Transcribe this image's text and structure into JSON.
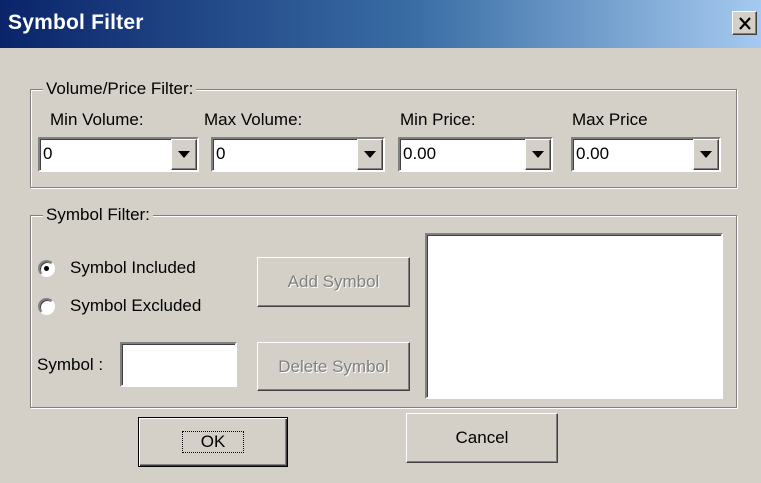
{
  "window": {
    "title": "Symbol Filter",
    "close_icon": "close-icon"
  },
  "volume_price_filter": {
    "legend": "Volume/Price Filter:",
    "min_volume": {
      "label": "Min Volume:",
      "value": "0"
    },
    "max_volume": {
      "label": "Max Volume:",
      "value": "0"
    },
    "min_price": {
      "label": "Min Price:",
      "value": "0.00"
    },
    "max_price": {
      "label": "Max Price",
      "value": "0.00"
    }
  },
  "symbol_filter": {
    "legend": "Symbol Filter:",
    "radio_included": {
      "label": "Symbol Included",
      "checked": true
    },
    "radio_excluded": {
      "label": "Symbol Excluded",
      "checked": false
    },
    "add_symbol_label": "Add Symbol",
    "delete_symbol_label": "Delete Symbol",
    "symbol_field": {
      "label": "Symbol :",
      "value": ""
    },
    "symbol_list": []
  },
  "buttons": {
    "ok_label": "OK",
    "cancel_label": "Cancel"
  }
}
